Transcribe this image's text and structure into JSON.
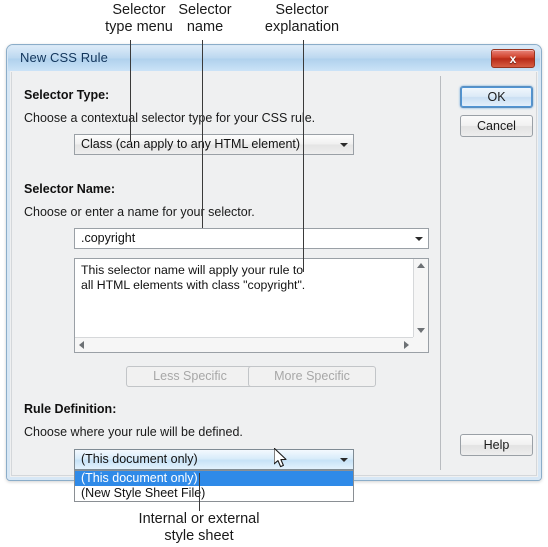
{
  "annotations": {
    "top": [
      {
        "id": "selector-type-menu",
        "text": "Selector\ntype menu"
      },
      {
        "id": "selector-name",
        "text": "Selector\nname"
      },
      {
        "id": "selector-explanation",
        "text": "Selector\nexplanation"
      }
    ],
    "bottom": [
      {
        "id": "internal-or-external-style-sheet",
        "text": "Internal or external\nstyle sheet"
      }
    ]
  },
  "dialog": {
    "title": "New CSS Rule",
    "close_label": "x",
    "selector_type": {
      "heading": "Selector Type:",
      "description": "Choose a contextual selector type for your CSS rule.",
      "value": "Class (can apply to any HTML element)"
    },
    "selector_name": {
      "heading": "Selector Name:",
      "description": "Choose or enter a name for your selector.",
      "value": ".copyright",
      "explanation": "This selector name will apply your rule to\nall HTML elements with class \"copyright\".",
      "less_specific_label": "Less Specific",
      "more_specific_label": "More Specific"
    },
    "rule_definition": {
      "heading": "Rule Definition:",
      "description": "Choose where your rule will be defined.",
      "value": "(This document only)",
      "options": [
        {
          "label": "(This document only)",
          "selected": true
        },
        {
          "label": "(New Style Sheet File)",
          "selected": false
        }
      ]
    },
    "buttons": {
      "ok": "OK",
      "cancel": "Cancel",
      "help": "Help"
    }
  },
  "colors": {
    "titlebar": "#bcd8f0",
    "dialog_bg": "#eff0f1",
    "close_red": "#d2452f",
    "highlight_blue": "#2f8ae8",
    "focus_blue": "#4f94d4"
  }
}
